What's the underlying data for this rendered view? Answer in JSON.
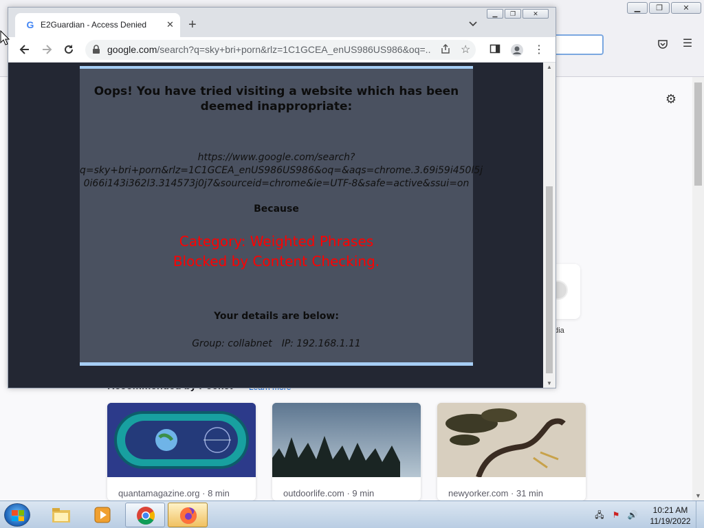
{
  "firefox": {
    "shortcut_label": "edia",
    "recommended_heading": "Recommended by Pocket",
    "learn_more": "Learn more",
    "cards": [
      {
        "meta": "quantamagazine.org · 8 min"
      },
      {
        "meta": "outdoorlife.com · 9 min"
      },
      {
        "meta": "newyorker.com · 31 min"
      }
    ]
  },
  "chrome": {
    "tab_title": "E2Guardian - Access Denied",
    "favicon_letter": "G",
    "url_host": "google.com",
    "url_rest": "/search?q=sky+bri+porn&rlz=1C1GCEA_enUS986US986&oq=..."
  },
  "block_page": {
    "heading": "Oops! You have tried visiting a website which has been deemed inappropriate:",
    "blocked_url": "https://www.google.com/search?\nq=sky+bri+porn&rlz=1C1GCEA_enUS986US986&oq=&aqs=chrome.3.69i59i450l5j\n0i66i143i362l3.314573j0j7&sourceid=chrome&ie=UTF-8&safe=active&ssui=on",
    "because": "Because",
    "reason_line1": "Category: Weighted Phrases",
    "reason_line2": "Blocked by Content Checking.",
    "details_label": "Your details are below:",
    "group": "Group: collabnet",
    "ip": "IP: 192.168.1.11"
  },
  "taskbar": {
    "time": "10:21 AM",
    "date": "11/19/2022"
  },
  "colors": {
    "block_bg": "#4a5160",
    "block_border": "#a6cdf4",
    "reason_red": "#ff0000",
    "content_bg": "#232733"
  }
}
